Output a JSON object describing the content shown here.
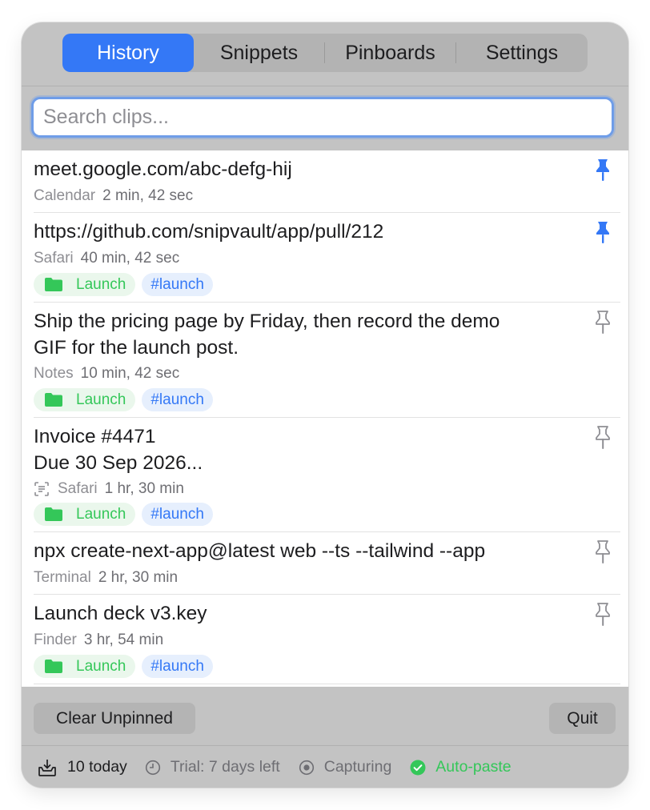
{
  "tabs": [
    "History",
    "Snippets",
    "Pinboards",
    "Settings"
  ],
  "search": {
    "placeholder": "Search clips..."
  },
  "clips": [
    {
      "title": "meet.google.com/abc-defg-hij",
      "app": "Calendar",
      "age": "2 min, 42 sec",
      "pinned": true
    },
    {
      "title": "https://github.com/snipvault/app/pull/212",
      "app": "Safari",
      "age": "40 min, 42 sec",
      "pinned": true,
      "folder": "Launch",
      "tag": "#launch"
    },
    {
      "title_lines": [
        "Ship the pricing page by Friday, then record the demo",
        "GIF for the launch post."
      ],
      "app": "Notes",
      "age": "10 min, 42 sec",
      "pinned": false,
      "folder": "Launch",
      "tag": "#launch"
    },
    {
      "title_lines": [
        "Invoice #4471",
        "Due 30 Sep 2026..."
      ],
      "app": "Safari",
      "age": "1 hr, 30 min",
      "pinned": false,
      "folder": "Launch",
      "tag": "#launch",
      "ocr": true
    },
    {
      "title": "npx create-next-app@latest web --ts --tailwind --app",
      "app": "Terminal",
      "age": "2 hr, 30 min",
      "pinned": false
    },
    {
      "title": "Launch deck v3.key",
      "app": "Finder",
      "age": "3 hr, 54 min",
      "pinned": false,
      "folder": "Launch",
      "tag": "#launch"
    }
  ],
  "buttons": {
    "clear": "Clear Unpinned",
    "quit": "Quit"
  },
  "status": {
    "today": "10 today",
    "trial": "Trial: 7 days left",
    "capturing": "Capturing",
    "autopaste": "Auto-paste"
  },
  "colors": {
    "accent": "#3478f6",
    "folder_green": "#34c759",
    "tag_blue": "#3478f6",
    "panel": "#c3c3c3"
  },
  "icons": {
    "pinned": "pin-filled-icon",
    "unpinned": "pin-outline-icon",
    "folder": "folder-icon",
    "ocr": "text-scan-icon"
  }
}
